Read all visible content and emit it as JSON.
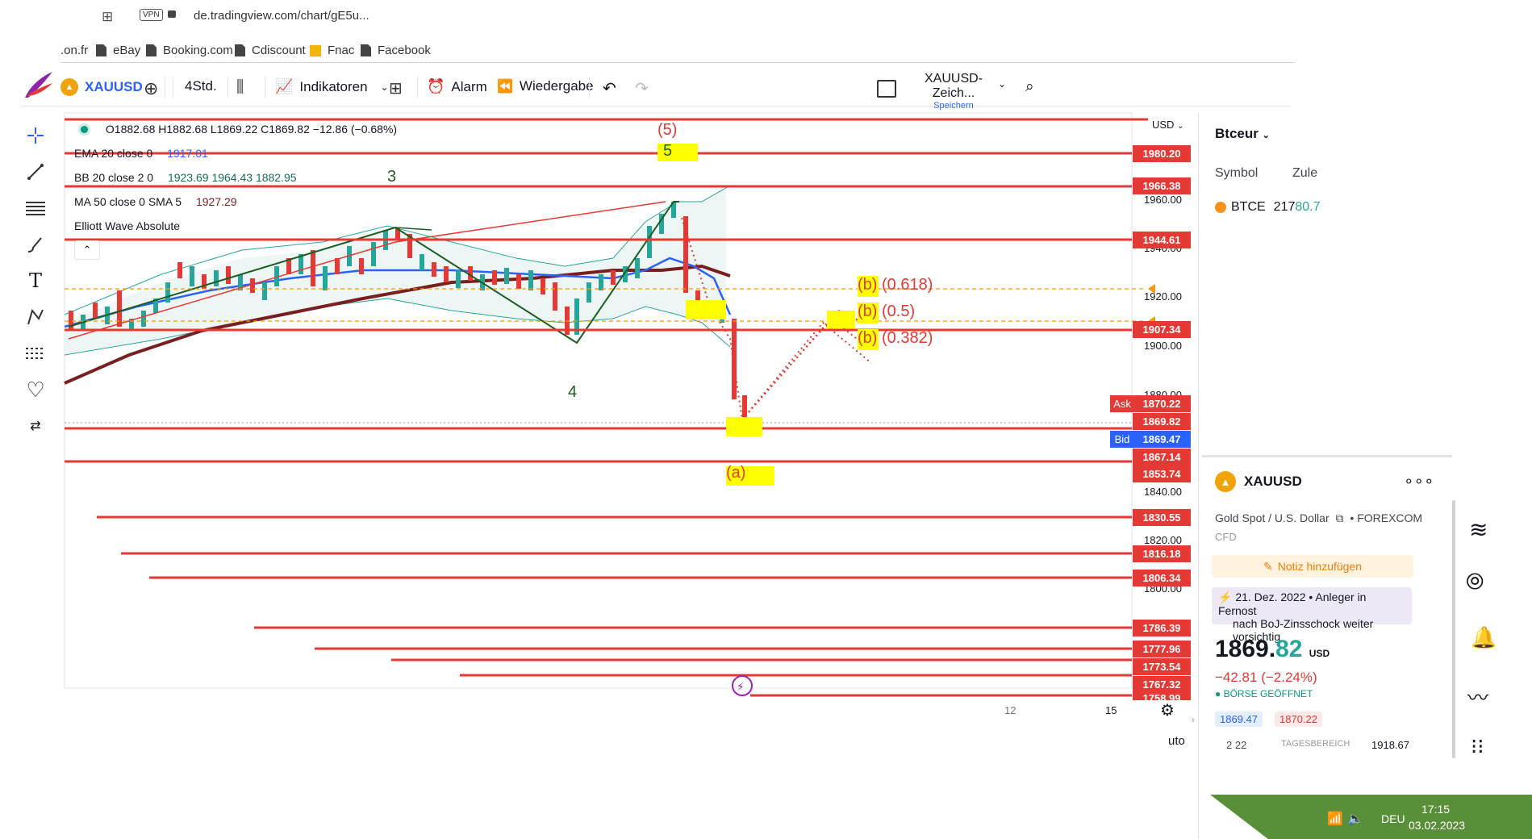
{
  "browser": {
    "vpn_label": "VPN",
    "url": "de.tradingview.com/chart/gE5u...",
    "bookmarks": [
      ".on.fr",
      "eBay",
      "Booking.com",
      "Cdiscount",
      "Fnac",
      "Facebook"
    ]
  },
  "toolbar": {
    "symbol": "XAUUSD",
    "interval": "4Std.",
    "indicators": "Indikatoren",
    "alert": "Alarm",
    "replay": "Wiedergabe",
    "layout_name": "XAUUSD-Zeich...",
    "save_label": "Speichern"
  },
  "legend": {
    "ohlc": "O1882.68  H1882.68  L1869.22  C1869.82  −12.86 (−0.68%)",
    "ema_label": "EMA 20 close 0",
    "ema_value": "1917.01",
    "bb_label": "BB 20 close 2 0",
    "bb_values": "1923.69  1964.43  1882.95",
    "ma_label": "MA 50 close 0 SMA 5",
    "ma_value": "1927.29",
    "elliott": "Elliott Wave Absolute"
  },
  "chart_annotations": {
    "wave_5_top": "(5)",
    "wave_5": "5",
    "wave_3": "3",
    "wave_4": "4",
    "wave_a": "(a)",
    "fib_618": "(b) (0.618)",
    "fib_5": "(b) (0.5)",
    "fib_382": "(b) (0.382)"
  },
  "price_scale": {
    "currency": "USD",
    "ask_tag": "Ask",
    "bid_tag": "Bid",
    "ticks": [
      "1960.00",
      "1940.00",
      "1920.00",
      "1900.00",
      "1880.00",
      "1840.00",
      "1820.00",
      "1800.00"
    ],
    "time_ticks": [
      "12",
      "15"
    ],
    "auto_label": "uto"
  },
  "price_labels": [
    {
      "value": "1980.20",
      "color": "#e53935"
    },
    {
      "value": "1966.38",
      "color": "#e53935"
    },
    {
      "value": "1944.61",
      "color": "#e53935"
    },
    {
      "value": "1907.34",
      "color": "#e53935"
    },
    {
      "value": "1870.22",
      "color": "#e53935"
    },
    {
      "value": "1869.82",
      "color": "#e53935"
    },
    {
      "value": "1869.47",
      "color": "#2962ff"
    },
    {
      "value": "1867.14",
      "color": "#e53935"
    },
    {
      "value": "1853.74",
      "color": "#e53935"
    },
    {
      "value": "1830.55",
      "color": "#e53935"
    },
    {
      "value": "1816.18",
      "color": "#e53935"
    },
    {
      "value": "1806.34",
      "color": "#e53935"
    },
    {
      "value": "1786.39",
      "color": "#e53935"
    },
    {
      "value": "1777.96",
      "color": "#e53935"
    },
    {
      "value": "1773.54",
      "color": "#e53935"
    },
    {
      "value": "1767.32",
      "color": "#e53935"
    },
    {
      "value": "1758.99",
      "color": "#e53935"
    }
  ],
  "watchlist": {
    "title": "Btceur",
    "col_symbol": "Symbol",
    "col_last": "Zule",
    "row_symbol": "BTCE",
    "row_value_main": "217",
    "row_value_accent": "80.7"
  },
  "details": {
    "symbol": "XAUUSD",
    "desc": "Gold Spot / U.S. Dollar",
    "exchange": "FOREXCOM",
    "type": "CFD",
    "note_button": "Notiz hinzufügen",
    "news_date": "21. Dez. 2022",
    "news_text_1": "Anleger in Fernost",
    "news_text_2": "nach BoJ-Zinsschock weiter vorsichtig",
    "price_main": "1869.",
    "price_decimals": "82",
    "price_currency": "USD",
    "change": "−42.81 (−2.24%)",
    "market_status": "BÖRSE GEÖFFNET",
    "bid": "1869.47",
    "ask": "1870.22",
    "range_low": "2 22",
    "range_label": "TAGESBEREICH",
    "range_high": "1918.67"
  },
  "taskbar": {
    "lang": "DEU",
    "time": "17:15",
    "date": "03.02.2023"
  },
  "colors": {
    "red": "#e53935",
    "green_candle": "#26a69a",
    "blue": "#2962ff",
    "yellow_highlight": "#ffff00",
    "wave_green": "#1b5e20"
  }
}
